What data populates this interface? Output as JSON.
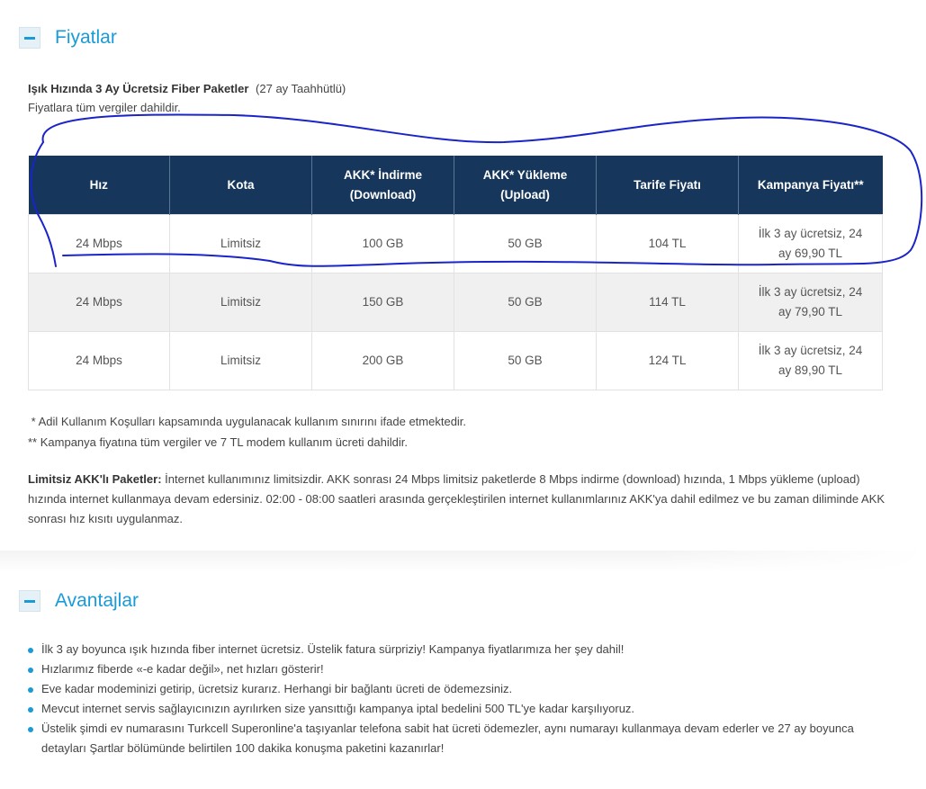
{
  "prices_section": {
    "title": "Fiyatlar",
    "package_title": "Işık Hızında 3 Ay Ücretsiz Fiber Paketler",
    "commitment": "(27 ay Taahhütlü)",
    "tax_note": "Fiyatlara tüm vergiler dahildir.",
    "table": {
      "headers": {
        "speed": "Hız",
        "quota": "Kota",
        "download_line1": "AKK* İndirme",
        "download_line2": "(Download)",
        "upload_line1": "AKK* Yükleme",
        "upload_line2": "(Upload)",
        "tariff": "Tarife Fiyatı",
        "campaign": "Kampanya Fiyatı**"
      },
      "rows": [
        {
          "speed": "24 Mbps",
          "quota": "Limitsiz",
          "download": "100 GB",
          "upload": "50 GB",
          "tariff": "104 TL",
          "campaign_line1": "İlk 3 ay ücretsiz, 24",
          "campaign_line2": "ay 69,90 TL"
        },
        {
          "speed": "24 Mbps",
          "quota": "Limitsiz",
          "download": "150 GB",
          "upload": "50 GB",
          "tariff": "114 TL",
          "campaign_line1": "İlk 3 ay ücretsiz, 24",
          "campaign_line2": "ay 79,90 TL"
        },
        {
          "speed": "24 Mbps",
          "quota": "Limitsiz",
          "download": "200 GB",
          "upload": "50 GB",
          "tariff": "124 TL",
          "campaign_line1": "İlk 3 ay ücretsiz, 24",
          "campaign_line2": "ay 89,90 TL"
        }
      ]
    },
    "footnote1": " * Adil Kullanım Koşulları kapsamında uygulanacak kullanım sınırını ifade etmektedir.",
    "footnote2": "** Kampanya fiyatına tüm vergiler ve 7 TL modem kullanım ücreti dahildir.",
    "limitless_label": "Limitsiz AKK'lı Paketler:",
    "limitless_text": " İnternet kullanımınız limitsizdir. AKK sonrası 24 Mbps limitsiz paketlerde 8 Mbps indirme (download) hızında, 1 Mbps yükleme (upload) hızında internet kullanmaya devam edersiniz. 02:00 - 08:00 saatleri arasında gerçekleştirilen internet kullanımlarınız AKK'ya dahil edilmez ve bu zaman diliminde AKK sonrası hız kısıtı uygulanmaz."
  },
  "advantages_section": {
    "title": "Avantajlar",
    "items": [
      "İlk 3 ay boyunca ışık hızında fiber internet ücretsiz. Üstelik fatura sürpriziy! Kampanya fiyatlarımıza her şey dahil!",
      "Hızlarımız fiberde «-e kadar değil», net hızları gösterir!",
      "Eve kadar modeminizi getirip, ücretsiz kurarız. Herhangi bir bağlantı ücreti de ödemezsiniz.",
      "Mevcut internet servis sağlayıcınızın ayrılırken size yansıttığı kampanya iptal bedelini 500 TL'ye kadar karşılıyoruz.",
      "Üstelik şimdi ev numarasını Turkcell Superonline'a taşıyanlar telefona sabit hat ücreti ödemezler, aynı numarayı kullanmaya devam ederler ve 27 ay boyunca detayları Şartlar bölümünde belirtilen 100 dakika konuşma paketini kazanırlar!"
    ]
  },
  "colors": {
    "accent": "#1a9ad6",
    "table_header_bg": "#16365b",
    "annotation_ink": "#1a24c9"
  },
  "icons": {
    "collapse": "minus-icon",
    "bullet": "bullet-dot-icon"
  }
}
